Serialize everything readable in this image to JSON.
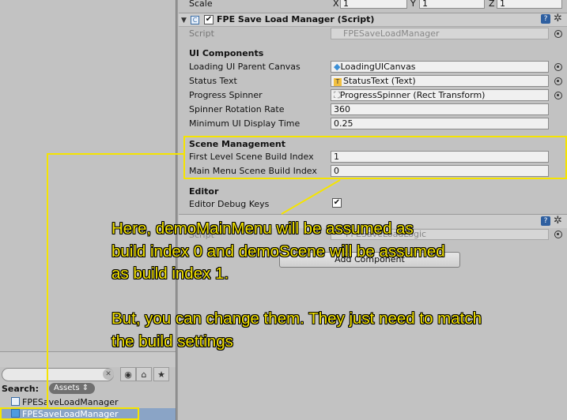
{
  "project": {
    "search_label": "Search:",
    "assets_filter": "Assets",
    "items": [
      {
        "label": "FPESaveLoadManager",
        "icon": "script-icon",
        "selected": false
      },
      {
        "label": "FPESaveLoadManager",
        "icon": "prefab-icon",
        "selected": true
      }
    ]
  },
  "inspector": {
    "scale": {
      "label": "Scale",
      "x_label": "X",
      "x": "1",
      "y_label": "Y",
      "y": "1",
      "z_label": "Z",
      "z": "1"
    },
    "component": {
      "title": "FPE Save Load Manager (Script)",
      "enabled": true,
      "script_label": "Script",
      "script_value": "FPESaveLoadManager",
      "ui_components_heading": "UI Components",
      "fields": {
        "loading_canvas": {
          "label": "Loading UI Parent Canvas",
          "value": "LoadingUICanvas",
          "icon": "gameobject-icon"
        },
        "status_text": {
          "label": "Status Text",
          "value": "StatusText (Text)",
          "icon": "text-icon"
        },
        "progress_spinner": {
          "label": "Progress Spinner",
          "value": "ProgressSpinner (Rect Transform)",
          "icon": "rect-transform-icon"
        },
        "rotation_rate": {
          "label": "Spinner Rotation Rate",
          "value": "360"
        },
        "min_display_time": {
          "label": "Minimum UI Display Time",
          "value": "0.25"
        }
      },
      "scene_management_heading": "Scene Management",
      "first_level_index": {
        "label": "First Level Scene Build Index",
        "value": "1"
      },
      "main_menu_index": {
        "label": "Main Menu Scene Build Index",
        "value": "0"
      },
      "editor_heading": "Editor",
      "editor_debug_keys": {
        "label": "Editor Debug Keys",
        "checked": true
      }
    },
    "second_component": {
      "script_label": "Script",
      "script_value": "FPESaveLoadLogic"
    },
    "add_component": "Add Component"
  },
  "annotation": {
    "text": "Here, demoMainMenu will be assumed as\nbuild index 0 and demoScene will be assumed\nas build index 1.\n\nBut, you can change them. They just need to match\nthe build settings",
    "color": "#f5e400"
  }
}
